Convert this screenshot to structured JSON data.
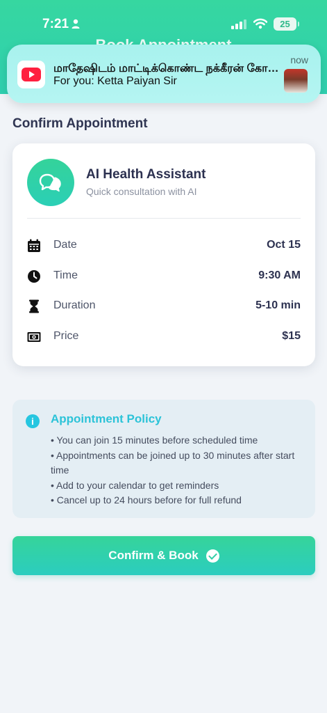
{
  "status_bar": {
    "time": "7:21",
    "battery": "25"
  },
  "header": {
    "title": "Book Appointment"
  },
  "notification": {
    "title": "மாதேஷிடம் மாட்டிக்கொண்ட நக்கீரன் கோபால்",
    "subtitle": "For you: Ketta Paiyan Sir",
    "time": "now",
    "app_icon": "youtube-icon"
  },
  "page": {
    "section_title": "Confirm Appointment"
  },
  "card": {
    "assistant_name": "AI Health Assistant",
    "assistant_subtitle": "Quick consultation with AI",
    "rows": [
      {
        "icon": "calendar-icon",
        "label": "Date",
        "value": "Oct 15"
      },
      {
        "icon": "clock-icon",
        "label": "Time",
        "value": "9:30 AM"
      },
      {
        "icon": "hourglass-icon",
        "label": "Duration",
        "value": "5-10 min"
      },
      {
        "icon": "money-icon",
        "label": "Price",
        "value": "$15"
      }
    ]
  },
  "policy": {
    "title": "Appointment Policy",
    "items": [
      "• You can join 15 minutes before scheduled time",
      "• Appointments can be joined up to 30 minutes after start time",
      "• Add to your calendar to get reminders",
      "• Cancel up to 24 hours before for full refund"
    ]
  },
  "confirm_button": {
    "label": "Confirm & Book"
  },
  "colors": {
    "accent": "#34d39a",
    "accent_teal": "#2bcfb6",
    "policy_title": "#2cc3d8",
    "background": "#f1f4f8"
  }
}
